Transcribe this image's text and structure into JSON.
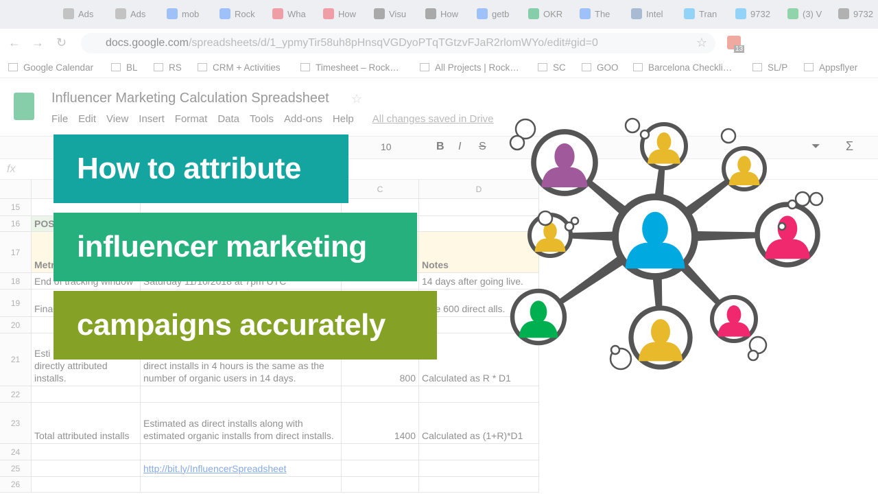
{
  "browser": {
    "tabs": [
      "Ads",
      "Ads",
      "mob",
      "Rock",
      "Wha",
      "How",
      "Visu",
      "How",
      "getb",
      "OKR",
      "The",
      "Intel",
      "Tran",
      "9732",
      "(3) V",
      "9732"
    ],
    "url_domain": "docs.google.com",
    "url_path": "/spreadsheets/d/1_ypmyTir58uh8pHnsqVGDyoPTqTGtzvFJaR2rlomWYo/edit#gid=0",
    "extension_badge": "13",
    "bookmarks": [
      "Google Calendar",
      "BL",
      "RS",
      "CRM + Activities",
      "Timesheet – Rock…",
      "All Projects | Rock…",
      "SC",
      "GOO",
      "Barcelona Checkli…",
      "SL/P",
      "Appsflyer"
    ]
  },
  "sheets": {
    "title": "Influencer Marketing Calculation Spreadsheet",
    "menu": [
      "File",
      "Edit",
      "View",
      "Insert",
      "Format",
      "Data",
      "Tools",
      "Add-ons",
      "Help"
    ],
    "saved_status": "All changes saved in Drive",
    "font_size": "10",
    "fx": "fx",
    "columns": [
      "C",
      "D"
    ],
    "rows": [
      {
        "n": "15",
        "a": "",
        "b": "",
        "c": "",
        "d": ""
      },
      {
        "n": "16",
        "a": "POS",
        "b": "",
        "c": "",
        "d": ""
      },
      {
        "n": "17",
        "a": "Metr",
        "b": "",
        "c": "",
        "d": "Notes"
      },
      {
        "n": "18",
        "a": "End of tracking window",
        "b": "Saturday 11/10/2018 at 7pm UTC",
        "c": "",
        "d": "14 days after going live."
      },
      {
        "n": "19",
        "a": "Fina insta",
        "b": "",
        "c": "",
        "d": "ume 600 direct alls."
      },
      {
        "n": "20",
        "a": "",
        "b": "",
        "c": "",
        "d": ""
      },
      {
        "n": "21",
        "a": "Esti as a result of directly attributed installs.",
        "b": "direct installs in 4 hours is the same as the number of organic users in 14 days.",
        "c": "800",
        "d": "Calculated as R * D1"
      },
      {
        "n": "22",
        "a": "",
        "b": "",
        "c": "",
        "d": ""
      },
      {
        "n": "23",
        "a": "Total attributed installs",
        "b": "Estimated as direct installs along with estimated organic installs from direct installs.",
        "c": "1400",
        "d": "Calculated as (1+R)*D1"
      },
      {
        "n": "24",
        "a": "",
        "b": "",
        "c": "",
        "d": ""
      },
      {
        "n": "25",
        "a": "",
        "b": "http://bit.ly/InfluencerSpreadsheet",
        "c": "",
        "d": ""
      },
      {
        "n": "26",
        "a": "",
        "b": "",
        "c": "",
        "d": ""
      }
    ]
  },
  "headline": {
    "line1": "How to attribute",
    "line2": "influencer marketing",
    "line3": "campaigns accurately",
    "colors": [
      "#14a5a0",
      "#25b07d",
      "#85a226"
    ]
  },
  "network": {
    "stroke_color": "#555555",
    "center_color": "#00a9e0",
    "node_colors": [
      "#a05a9c",
      "#e8b92a",
      "#e8b92a",
      "#f0286e",
      "#f0286e",
      "#e8b92a",
      "#00b050",
      "#e8b92a"
    ]
  }
}
